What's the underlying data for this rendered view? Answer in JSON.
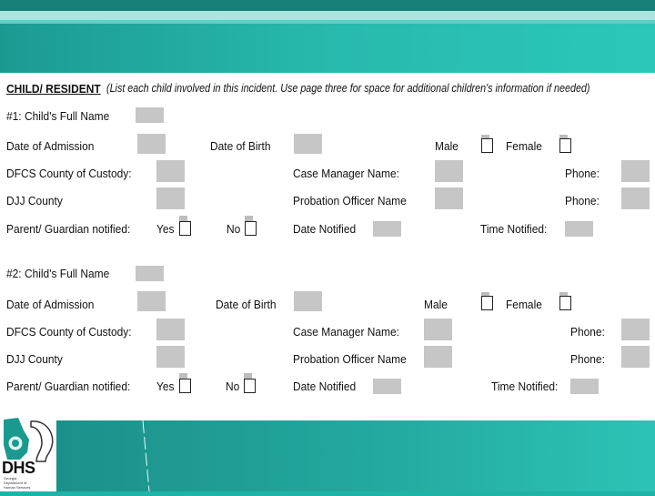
{
  "header": {
    "section_title": "CHILD/ RESIDENT",
    "instructions": "(List each child involved in this incident. Use page three for space for additional children's information if needed)"
  },
  "children": [
    {
      "name_label": "#1: Child's Full Name",
      "admission_label": "Date of Admission",
      "birth_label": "Date of Birth",
      "male_label": "Male",
      "female_label": "Female",
      "dfcs_label": "DFCS County of Custody:",
      "case_manager_label": "Case Manager Name:",
      "phone1_label": "Phone:",
      "djj_label": "DJJ County",
      "probation_label": "Probation Officer Name",
      "phone2_label": "Phone:",
      "parent_label": "Parent/ Guardian notified:",
      "yes_label": "Yes",
      "no_label": "No",
      "date_notified_label": "Date Notified",
      "time_notified_label": "Time Notified:"
    },
    {
      "name_label": "#2: Child's Full Name",
      "admission_label": "Date of Admission",
      "birth_label": "Date of Birth",
      "male_label": "Male",
      "female_label": "Female",
      "dfcs_label": "DFCS County of Custody:",
      "case_manager_label": "Case Manager Name:",
      "phone1_label": "Phone:",
      "djj_label": "DJJ County",
      "probation_label": "Probation Officer Name",
      "phone2_label": "Phone:",
      "parent_label": "Parent/ Guardian notified:",
      "yes_label": "Yes",
      "no_label": "No",
      "date_notified_label": "Date Notified",
      "time_notified_label": "Time Notified:"
    }
  ],
  "logo": {
    "abbr": "DHS",
    "caption": "Georgia Department of Human Services"
  },
  "colors": {
    "teal": "#1fb3a8",
    "field_gray": "#c6c6c6"
  }
}
